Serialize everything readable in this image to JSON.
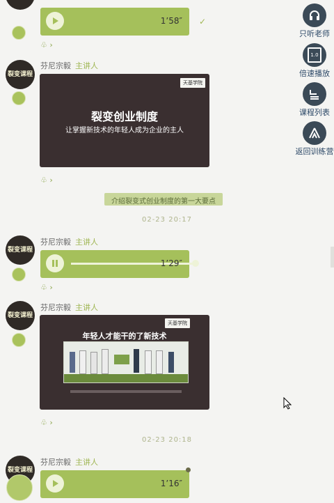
{
  "messages": {
    "m0": {
      "duration": "1’58″"
    },
    "m1": {
      "speaker": "芬尼宗毅",
      "role": "主讲人",
      "slide_title": "裂变创业制度",
      "slide_subtitle": "让掌握新技术的年轻人成为企业的主人",
      "logo": "天基学院"
    },
    "notice": "介绍裂变式创业制度的第一大要点",
    "time1": "02-23 20:17",
    "m2": {
      "speaker": "芬尼宗毅",
      "role": "主讲人",
      "duration": "1’29″",
      "progress": 1.0
    },
    "m3": {
      "speaker": "芬尼宗毅",
      "role": "主讲人",
      "slide_title": "年轻人才能干的了新技术",
      "logo": "天基学院"
    },
    "time2": "02-23 20:18",
    "m4": {
      "speaker": "芬尼宗毅",
      "role": "主讲人",
      "duration": "1’16″"
    }
  },
  "avatar_text": "裂变课程",
  "sidebar": {
    "listen": "只听老师",
    "speed": "倍速播放",
    "speed_icon": "1.0",
    "courses": "课程列表",
    "back": "返回训练营"
  },
  "colors": {
    "accent": "#a5c05b",
    "sidebar_icon": "#3b4a57",
    "label": "#2c4867",
    "slide_bg": "#3a2f30"
  }
}
